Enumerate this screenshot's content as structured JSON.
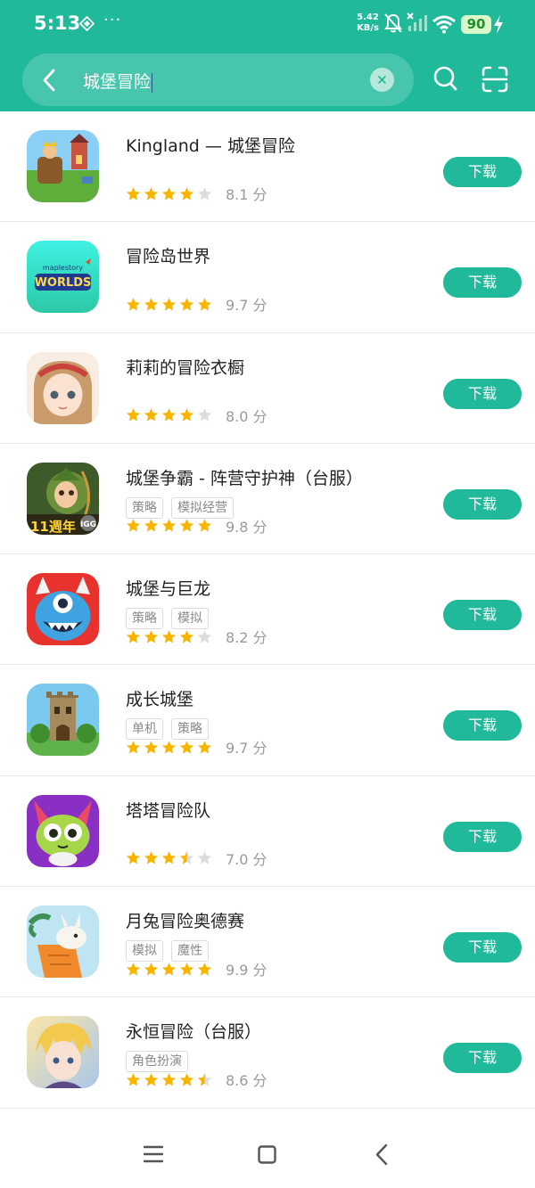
{
  "status_bar": {
    "time": "5:13",
    "dots": "···",
    "net_speed_value": "5.42",
    "net_speed_unit": "KB/s",
    "battery": "90"
  },
  "search": {
    "query": "城堡冒险"
  },
  "colors": {
    "accent": "#20b99a",
    "star": "#f7b500",
    "star_empty": "#dcdcdc"
  },
  "apps": [
    {
      "name": "Kingland — 城堡冒险",
      "tags": [],
      "stars": 4,
      "score": "8.1 分",
      "action": "下载",
      "icon": "kingland-icon"
    },
    {
      "name": "冒险岛世界",
      "tags": [],
      "stars": 5,
      "score": "9.7 分",
      "action": "下载",
      "icon": "maplestory-worlds-icon"
    },
    {
      "name": "莉莉的冒险衣橱",
      "tags": [],
      "stars": 4,
      "score": "8.0 分",
      "action": "下载",
      "icon": "lily-wardrobe-icon"
    },
    {
      "name": "城堡争霸 - 阵营守护神（台服）",
      "tags": [
        "策略",
        "模拟经营"
      ],
      "stars": 5,
      "score": "9.8 分",
      "action": "下载",
      "icon": "castle-clash-icon"
    },
    {
      "name": "城堡与巨龙",
      "tags": [
        "策略",
        "模拟"
      ],
      "stars": 4,
      "score": "8.2 分",
      "action": "下载",
      "icon": "castle-dragon-icon"
    },
    {
      "name": "成长城堡",
      "tags": [
        "单机",
        "策略"
      ],
      "stars": 5,
      "score": "9.7 分",
      "action": "下载",
      "icon": "grow-castle-icon"
    },
    {
      "name": "塔塔冒险队",
      "tags": [],
      "stars": 3.5,
      "score": "7.0 分",
      "action": "下载",
      "icon": "tata-adventure-icon"
    },
    {
      "name": "月兔冒险奥德赛",
      "tags": [
        "模拟",
        "魔性"
      ],
      "stars": 5,
      "score": "9.9 分",
      "action": "下载",
      "icon": "moon-rabbit-icon"
    },
    {
      "name": "永恒冒险（台服）",
      "tags": [
        "角色扮演"
      ],
      "stars": 4.5,
      "score": "8.6 分",
      "action": "下载",
      "icon": "eternal-adventure-icon"
    }
  ]
}
